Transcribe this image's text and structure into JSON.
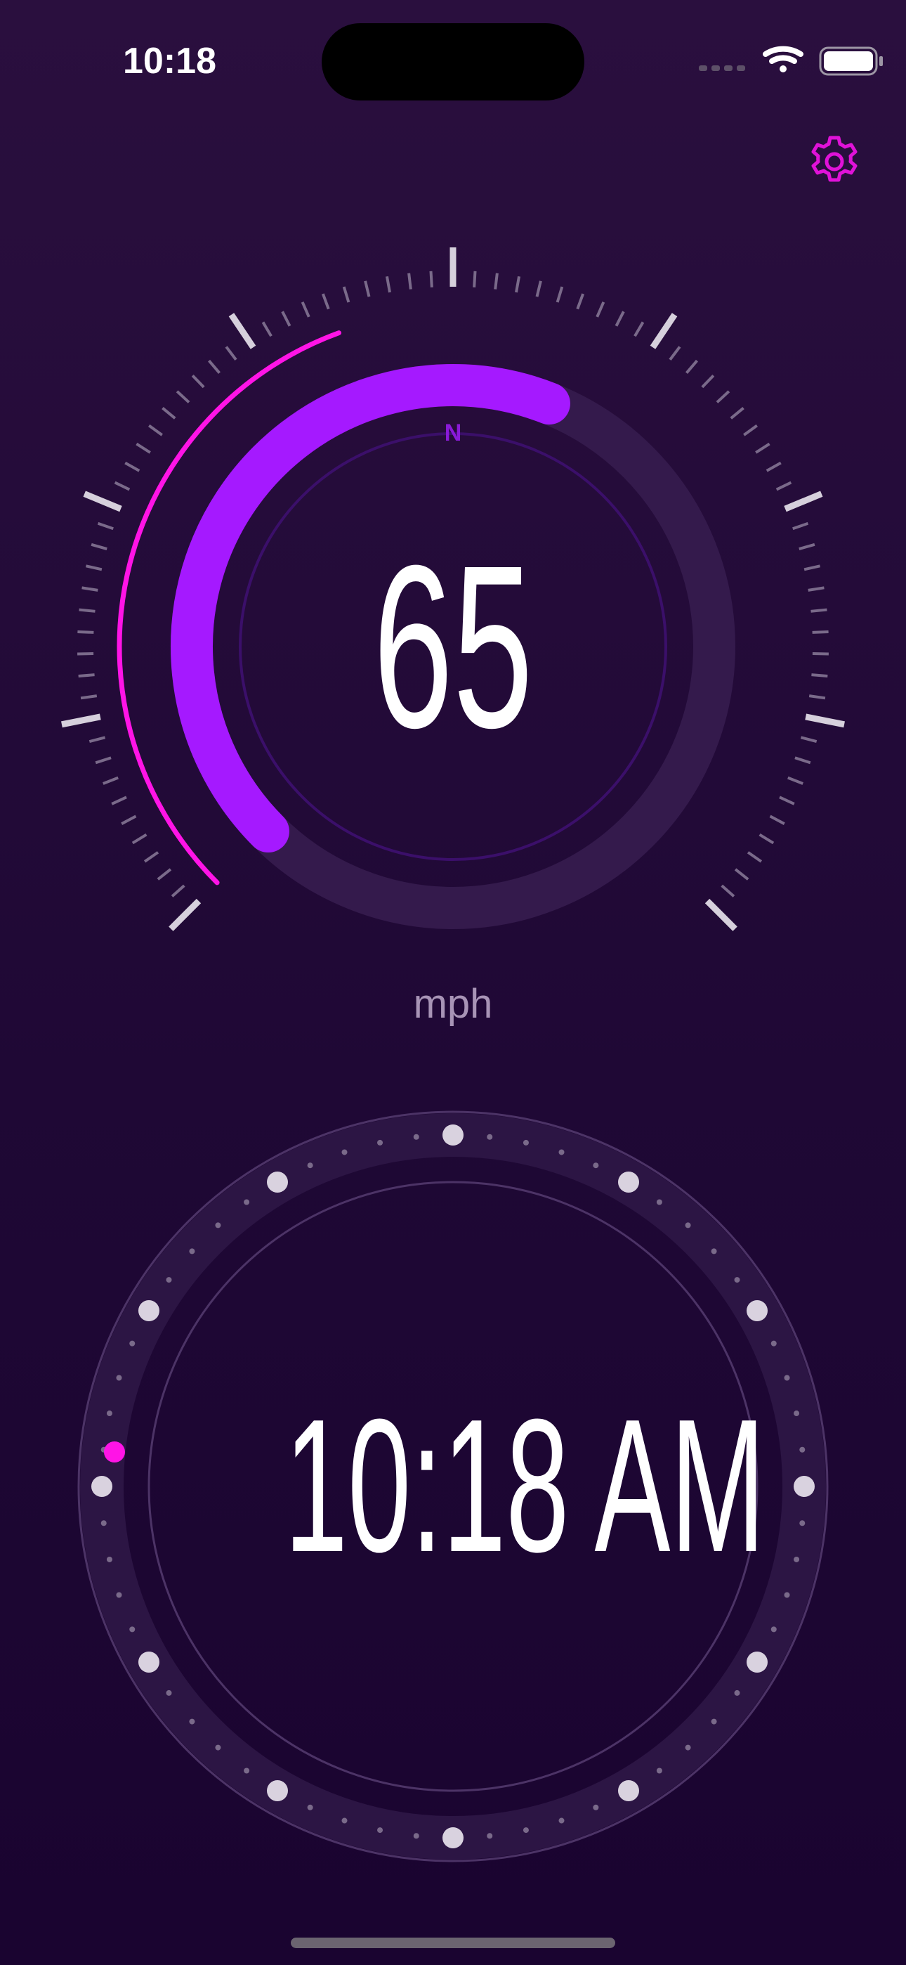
{
  "status_bar": {
    "time": "10:18",
    "icons": [
      "cellular-icon",
      "wifi-icon",
      "battery-icon"
    ]
  },
  "settings": {
    "icon": "gear-icon"
  },
  "speedometer": {
    "value": "65",
    "unit": "mph",
    "compass_heading": "N",
    "speed_fraction": 0.58
  },
  "clock": {
    "time": "10:18 AM"
  },
  "colors": {
    "accent": "#ff14e6",
    "arc": "#a020f0",
    "background": "#230a3a"
  }
}
